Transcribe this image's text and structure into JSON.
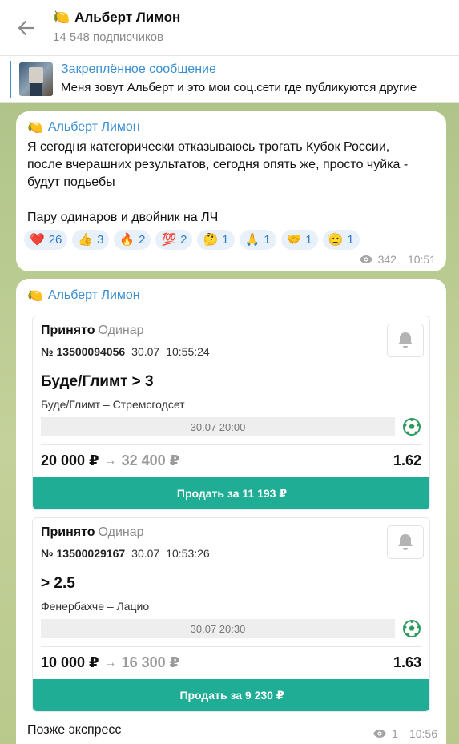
{
  "header": {
    "title": "Альберт Лимон",
    "subtitle": "14 548 подписчиков",
    "title_emoji": "lemon-icon"
  },
  "pinned": {
    "title": "Закреплённое сообщение",
    "text": "Меня зовут Альберт и это мои соц.сети где публикуются другие"
  },
  "message1": {
    "sender": "Альберт Лимон",
    "text_lines": [
      "Я сегодня категорически отказываюсь трогать Кубок России,",
      "после вчерашних результатов, сегодня опять же, просто чуйка -",
      "будут подьебы",
      "",
      "Пару одинаров и двойник на ЛЧ"
    ],
    "reactions": [
      {
        "emoji": "❤️",
        "icon": "heart-icon",
        "count": "26"
      },
      {
        "emoji": "👍",
        "icon": "thumbs-up-icon",
        "count": "3"
      },
      {
        "emoji": "🔥",
        "icon": "fire-icon",
        "count": "2"
      },
      {
        "emoji": "💯",
        "icon": "hundred-icon",
        "count": "2"
      },
      {
        "emoji": "🤔",
        "icon": "thinking-icon",
        "count": "1"
      },
      {
        "emoji": "🙏",
        "icon": "pray-icon",
        "count": "1"
      },
      {
        "emoji": "🤝",
        "icon": "handshake-icon",
        "count": "1"
      },
      {
        "emoji": "🫡",
        "icon": "salute-icon",
        "count": "1"
      }
    ],
    "views": "342",
    "time": "10:51"
  },
  "message2": {
    "sender": "Альберт Лимон",
    "bets": [
      {
        "status": "Принято",
        "type": "Одинар",
        "number": "№ 13500094056",
        "date": "30.07",
        "time": "10:55:24",
        "pick": "Буде/Глимт > 3",
        "event": "Буде/Глимт – Стремсгодсет",
        "event_datetime": "30.07 20:00",
        "stake": "20 000 ₽",
        "win": "32 400 ₽",
        "odds": "1.62",
        "sell_label": "Продать за 11 193 ₽"
      },
      {
        "status": "Принято",
        "type": "Одинар",
        "number": "№ 13500029167",
        "date": "30.07",
        "time": "10:53:26",
        "pick": "> 2.5",
        "event": "Фенербахче – Лацио",
        "event_datetime": "30.07 20:30",
        "stake": "10 000 ₽",
        "win": "16 300 ₽",
        "odds": "1.63",
        "sell_label": "Продать за 9 230 ₽"
      }
    ],
    "caption": "Позже экспресс",
    "views": "1",
    "time": "10:56"
  },
  "colors": {
    "accent_blue": "#3a8fd1",
    "sell_green": "#1fad96",
    "reaction_bg": "#e8f1fa"
  }
}
